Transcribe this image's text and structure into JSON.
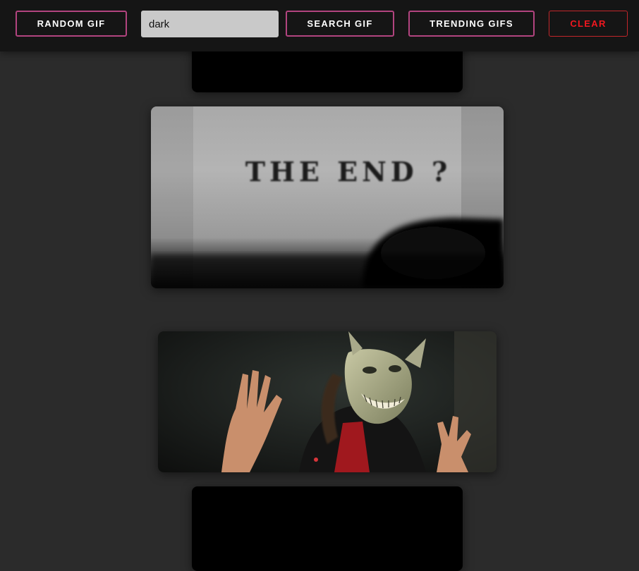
{
  "toolbar": {
    "random_label": "RANDOM GIF",
    "search_value": "dark",
    "search_label": "SEARCH GIF",
    "trending_label": "TRENDING GIFS",
    "clear_label": "CLEAR"
  },
  "gifs": [
    {
      "kind": "black-frame"
    },
    {
      "kind": "typewriter",
      "caption": "THE END ?"
    },
    {
      "kind": "masked-figure"
    },
    {
      "kind": "black-frame"
    }
  ],
  "colors": {
    "background": "#2b2b2b",
    "toolbar": "#151515",
    "button_border": "#b2447f",
    "clear_text": "#f0171f"
  }
}
